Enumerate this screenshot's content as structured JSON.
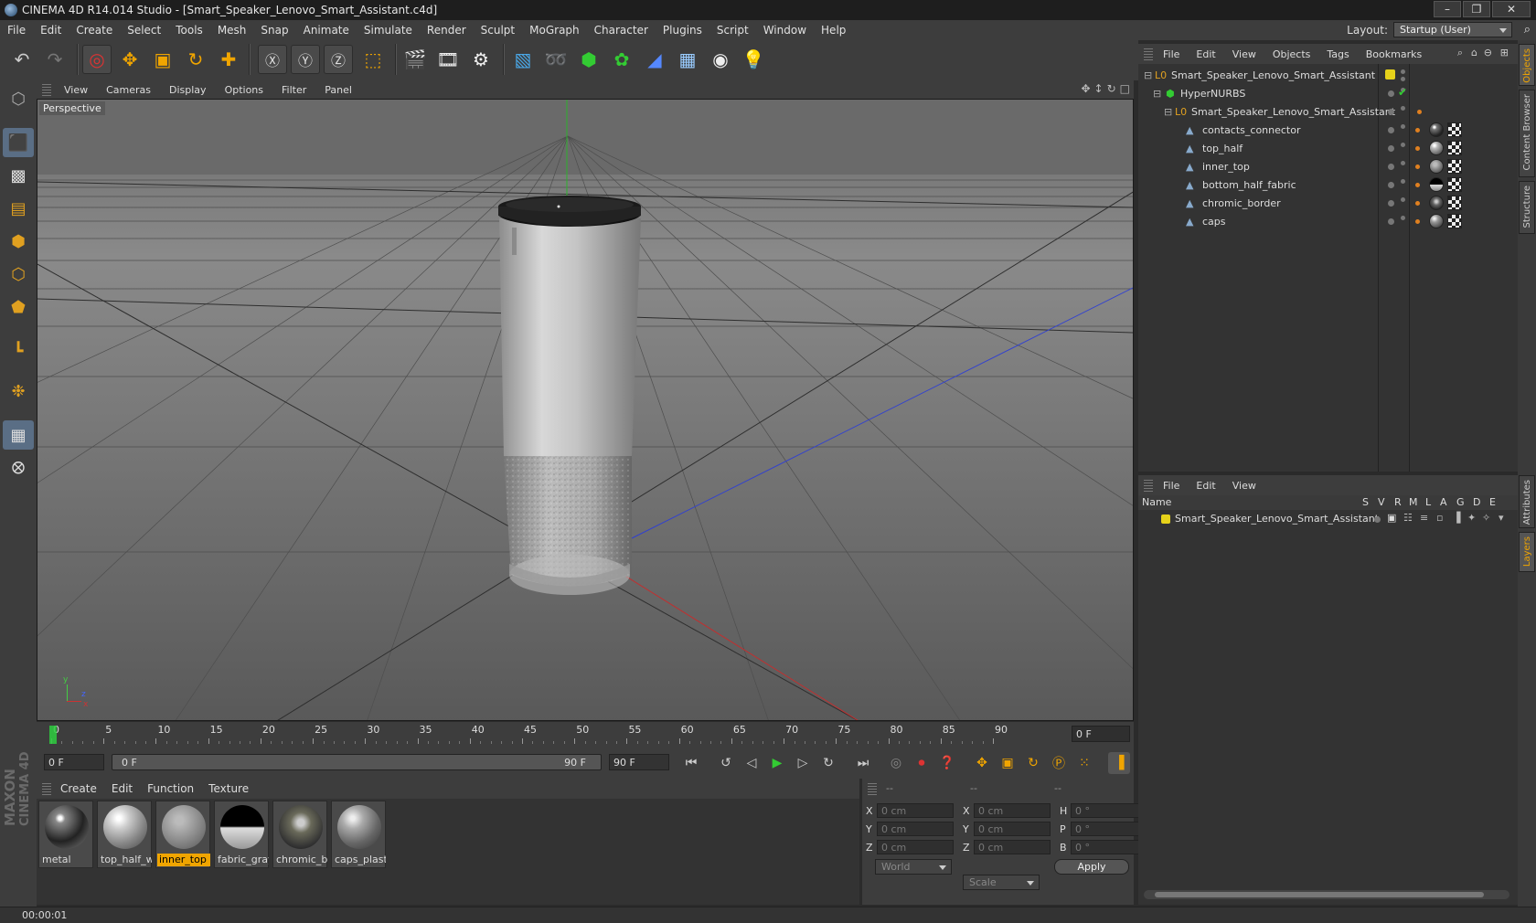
{
  "window": {
    "title": "CINEMA 4D R14.014 Studio - [Smart_Speaker_Lenovo_Smart_Assistant.c4d]",
    "controls": [
      "–",
      "❐",
      "✕"
    ]
  },
  "menubar": {
    "items": [
      "File",
      "Edit",
      "Create",
      "Select",
      "Tools",
      "Mesh",
      "Snap",
      "Animate",
      "Simulate",
      "Render",
      "Sculpt",
      "MoGraph",
      "Character",
      "Plugins",
      "Script",
      "Window",
      "Help"
    ],
    "layout_label": "Layout:",
    "layout_value": "Startup (User)"
  },
  "viewport": {
    "menu": [
      "View",
      "Cameras",
      "Display",
      "Options",
      "Filter",
      "Panel"
    ],
    "label": "Perspective",
    "axis": {
      "y": "y",
      "z": "z",
      "x": "x"
    }
  },
  "timeline": {
    "ticks": [
      "0",
      "5",
      "10",
      "15",
      "20",
      "25",
      "30",
      "35",
      "40",
      "45",
      "50",
      "55",
      "60",
      "65",
      "70",
      "75",
      "80",
      "85",
      "90"
    ],
    "current_frame": "0 F"
  },
  "transport": {
    "start_field": "0 F",
    "range_start": "0 F",
    "range_end": "90 F",
    "end_field": "90 F"
  },
  "materials": {
    "menu": [
      "Create",
      "Edit",
      "Function",
      "Texture"
    ],
    "items": [
      {
        "label": "metal",
        "selected": false
      },
      {
        "label": "top_half_w",
        "selected": false
      },
      {
        "label": "inner_top",
        "selected": true
      },
      {
        "label": "fabric_gray",
        "selected": false
      },
      {
        "label": "chromic_bc",
        "selected": false
      },
      {
        "label": "caps_plasti",
        "selected": false
      }
    ]
  },
  "coords": {
    "headers": [
      "--",
      "--",
      "--"
    ],
    "rows": [
      {
        "l1": "X",
        "v1": "0 cm",
        "l2": "X",
        "v2": "0 cm",
        "l3": "H",
        "v3": "0 °"
      },
      {
        "l1": "Y",
        "v1": "0 cm",
        "l2": "Y",
        "v2": "0 cm",
        "l3": "P",
        "v3": "0 °"
      },
      {
        "l1": "Z",
        "v1": "0 cm",
        "l2": "Z",
        "v2": "0 cm",
        "l3": "B",
        "v3": "0 °"
      }
    ],
    "mode1": "World",
    "mode2": "Scale",
    "apply": "Apply"
  },
  "status": {
    "time": "00:00:01"
  },
  "object_manager": {
    "menu": [
      "File",
      "Edit",
      "View",
      "Objects",
      "Tags",
      "Bookmarks"
    ],
    "objects": [
      {
        "name": "Smart_Speaker_Lenovo_Smart_Assistant",
        "indent": 0
      },
      {
        "name": "HyperNURBS",
        "indent": 1
      },
      {
        "name": "Smart_Speaker_Lenovo_Smart_Assistant",
        "indent": 2
      },
      {
        "name": "contacts_connector",
        "indent": 3
      },
      {
        "name": "top_half",
        "indent": 3
      },
      {
        "name": "inner_top",
        "indent": 3
      },
      {
        "name": "bottom_half_fabric",
        "indent": 3
      },
      {
        "name": "chromic_border",
        "indent": 3
      },
      {
        "name": "caps",
        "indent": 3
      }
    ]
  },
  "layer_manager": {
    "menu": [
      "File",
      "Edit",
      "View"
    ],
    "columns": [
      "Name",
      "S",
      "V",
      "R",
      "M",
      "L",
      "A",
      "G",
      "D",
      "E"
    ],
    "layers": [
      {
        "name": "Smart_Speaker_Lenovo_Smart_Assistant",
        "color": "#e6d21a"
      }
    ]
  },
  "right_tabs": [
    "Objects",
    "Content Browser",
    "Structure",
    "Attributes",
    "Layers"
  ],
  "colors": {
    "accent": "#f0a500",
    "active_tool": "#5a6e85",
    "axis_x": "#c03030",
    "axis_y": "#30b030",
    "axis_z": "#3040d0"
  }
}
